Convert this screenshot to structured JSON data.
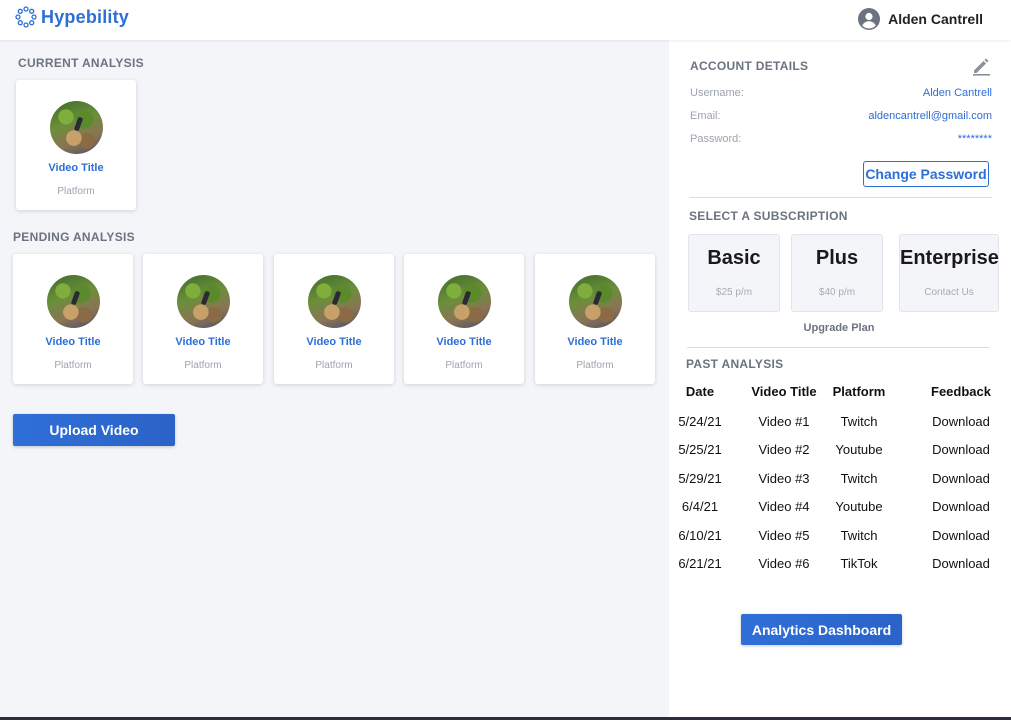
{
  "app": {
    "brand_name": "Hypebility",
    "accent_color": "#2c6fd6"
  },
  "header": {
    "user_name": "Alden Cantrell"
  },
  "current_analysis": {
    "heading": "CURRENT ANALYSIS",
    "videos": [
      {
        "title": "Video Title",
        "platform": "Platform"
      }
    ]
  },
  "pending_analysis": {
    "heading": "PENDING ANALYSIS",
    "videos": [
      {
        "title": "Video Title",
        "platform": "Platform"
      },
      {
        "title": "Video Title",
        "platform": "Platform"
      },
      {
        "title": "Video Title",
        "platform": "Platform"
      },
      {
        "title": "Video Title",
        "platform": "Platform"
      },
      {
        "title": "Video Title",
        "platform": "Platform"
      }
    ]
  },
  "upload_button": "Upload Video",
  "account": {
    "heading": "ACCOUNT DETAILS",
    "username_label": "Username:",
    "username": "Alden Cantrell",
    "email_label": "Email:",
    "email": "aldencantrell@gmail.com",
    "password_label": "Password:",
    "password": "********",
    "change_password_button": "Change Password"
  },
  "subscription": {
    "heading": "SELECT A SUBSCRIPTION",
    "plans": [
      {
        "name": "Basic",
        "price": "$25 p/m"
      },
      {
        "name": "Plus",
        "price": "$40 p/m"
      },
      {
        "name": "Enterprise",
        "price": "Contact Us"
      }
    ],
    "upgrade_label": "Upgrade Plan"
  },
  "past_analysis": {
    "heading": "PAST ANALYSIS",
    "columns": [
      "Date",
      "Video Title",
      "Platform",
      "Feedback"
    ],
    "rows": [
      [
        "5/24/21",
        "Video #1",
        "Twitch",
        "Download"
      ],
      [
        "5/25/21",
        "Video #2",
        "Youtube",
        "Download"
      ],
      [
        "5/29/21",
        "Video #3",
        "Twitch",
        "Download"
      ],
      [
        "6/4/21",
        "Video #4",
        "Youtube",
        "Download"
      ],
      [
        "6/10/21",
        "Video #5",
        "Twitch",
        "Download"
      ],
      [
        "6/21/21",
        "Video #6",
        "TikTok",
        "Download"
      ]
    ]
  },
  "analytics_button": "Analytics Dashboard"
}
